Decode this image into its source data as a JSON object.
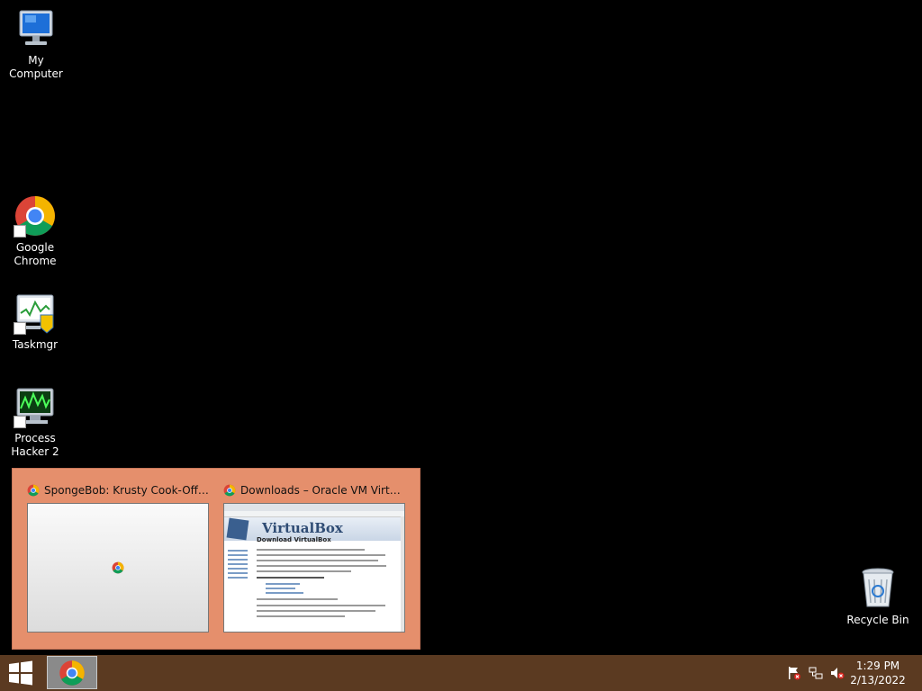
{
  "desktop": {
    "icons": [
      {
        "label": "My Computer",
        "icon": "computer-icon"
      },
      {
        "label": "Google Chrome",
        "icon": "chrome-icon"
      },
      {
        "label": "Taskmgr",
        "icon": "taskmgr-icon"
      },
      {
        "label": "Process Hacker 2",
        "icon": "process-hacker-icon"
      },
      {
        "label": "Recycle Bin",
        "icon": "recycle-bin-icon"
      }
    ]
  },
  "preview": {
    "windows": [
      {
        "title": "SpongeBob: Krusty Cook-Off H..."
      },
      {
        "title": "Downloads – Oracle VM Virtual..."
      }
    ],
    "virtualbox_page": {
      "brand": "VirtualBox",
      "heading": "Download VirtualBox"
    }
  },
  "taskbar": {
    "time": "1:29 PM",
    "date": "2/13/2022",
    "tray": [
      "action-center-flag-icon",
      "network-icon",
      "volume-muted-icon"
    ]
  },
  "colors": {
    "taskbar": "#5b3a21",
    "preview_bg": "#e58f6c",
    "desktop": "#000000"
  }
}
